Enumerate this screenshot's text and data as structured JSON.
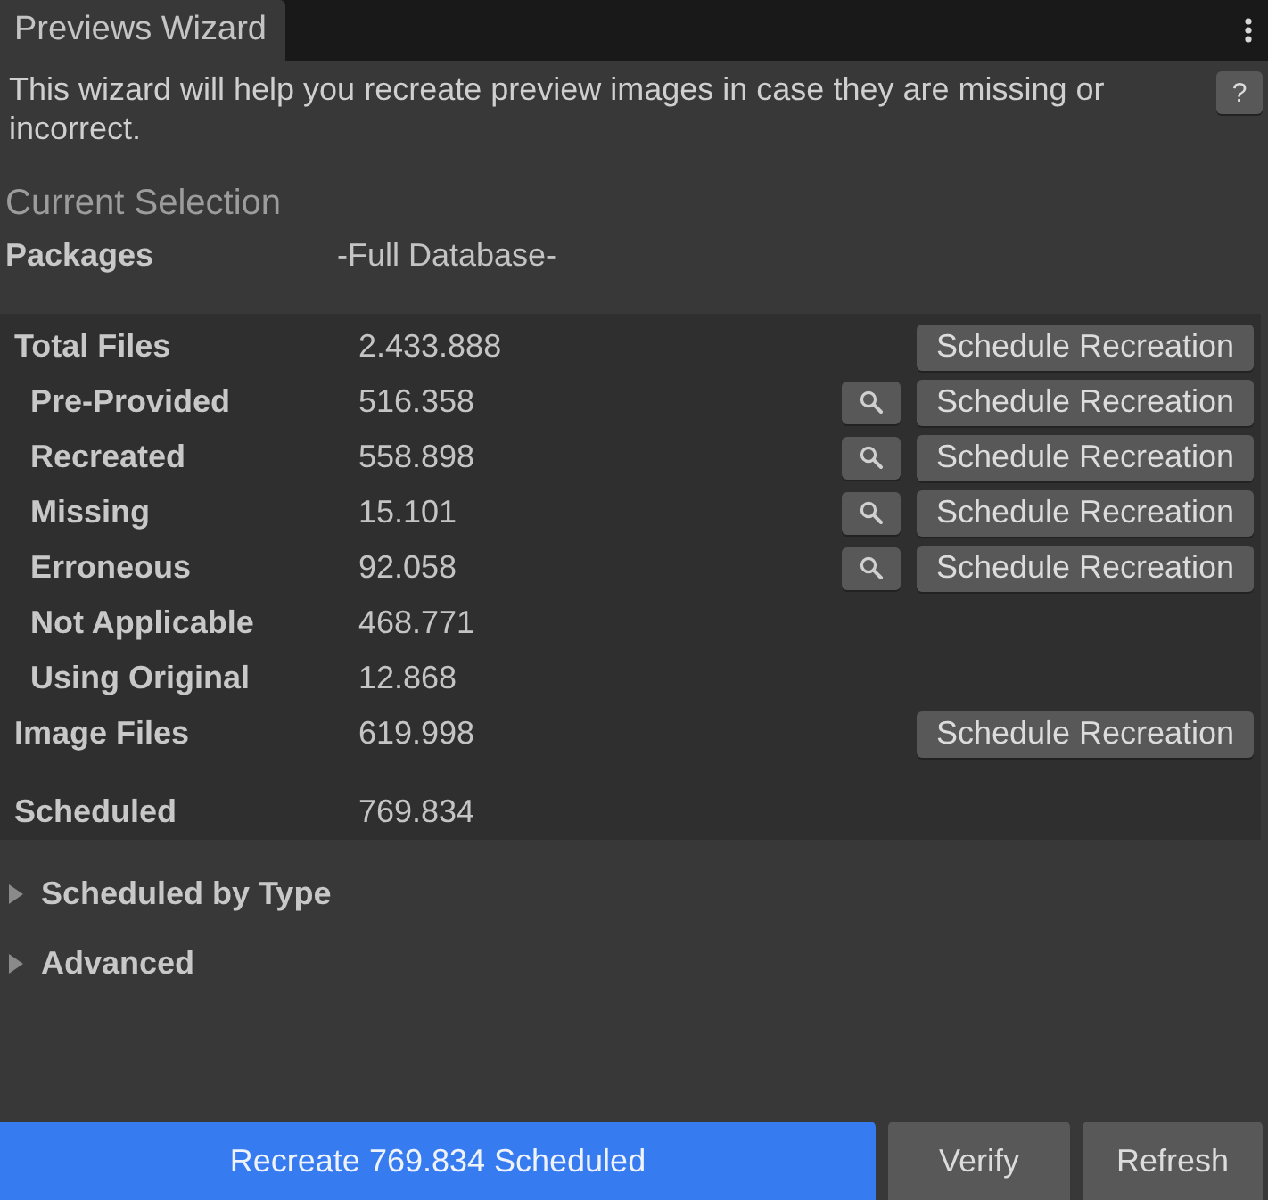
{
  "window": {
    "tab_title": "Previews Wizard"
  },
  "intro": {
    "text": "This wizard will help you recreate preview images in case they are missing or incorrect.",
    "help_button": "?"
  },
  "current_selection": {
    "heading": "Current Selection",
    "fields": [
      {
        "label": "Packages",
        "value": "-Full Database-"
      }
    ]
  },
  "stats": {
    "rows": [
      {
        "label": "Total Files",
        "value": "2.433.888",
        "search_button": false,
        "action": "Schedule Recreation",
        "children": [
          {
            "label": "Pre-Provided",
            "value": "516.358",
            "search_button": true,
            "action": "Schedule Recreation"
          },
          {
            "label": "Recreated",
            "value": "558.898",
            "search_button": true,
            "action": "Schedule Recreation"
          },
          {
            "label": "Missing",
            "value": "15.101",
            "search_button": true,
            "action": "Schedule Recreation"
          },
          {
            "label": "Erroneous",
            "value": "92.058",
            "search_button": true,
            "action": "Schedule Recreation"
          },
          {
            "label": "Not Applicable",
            "value": "468.771",
            "search_button": false
          },
          {
            "label": "Using Original",
            "value": "12.868",
            "search_button": false
          }
        ]
      },
      {
        "label": "Image Files",
        "value": "619.998",
        "search_button": false,
        "action": "Schedule Recreation"
      }
    ],
    "scheduled": {
      "label": "Scheduled",
      "value": "769.834"
    }
  },
  "foldouts": [
    {
      "label": "Scheduled by Type",
      "expanded": false
    },
    {
      "label": "Advanced",
      "expanded": false
    }
  ],
  "footer": {
    "buttons": [
      {
        "kind": "primary",
        "label": "Recreate 769.834 Scheduled"
      },
      {
        "kind": "secondary",
        "label": "Verify"
      },
      {
        "kind": "secondary",
        "label": "Refresh"
      }
    ]
  }
}
